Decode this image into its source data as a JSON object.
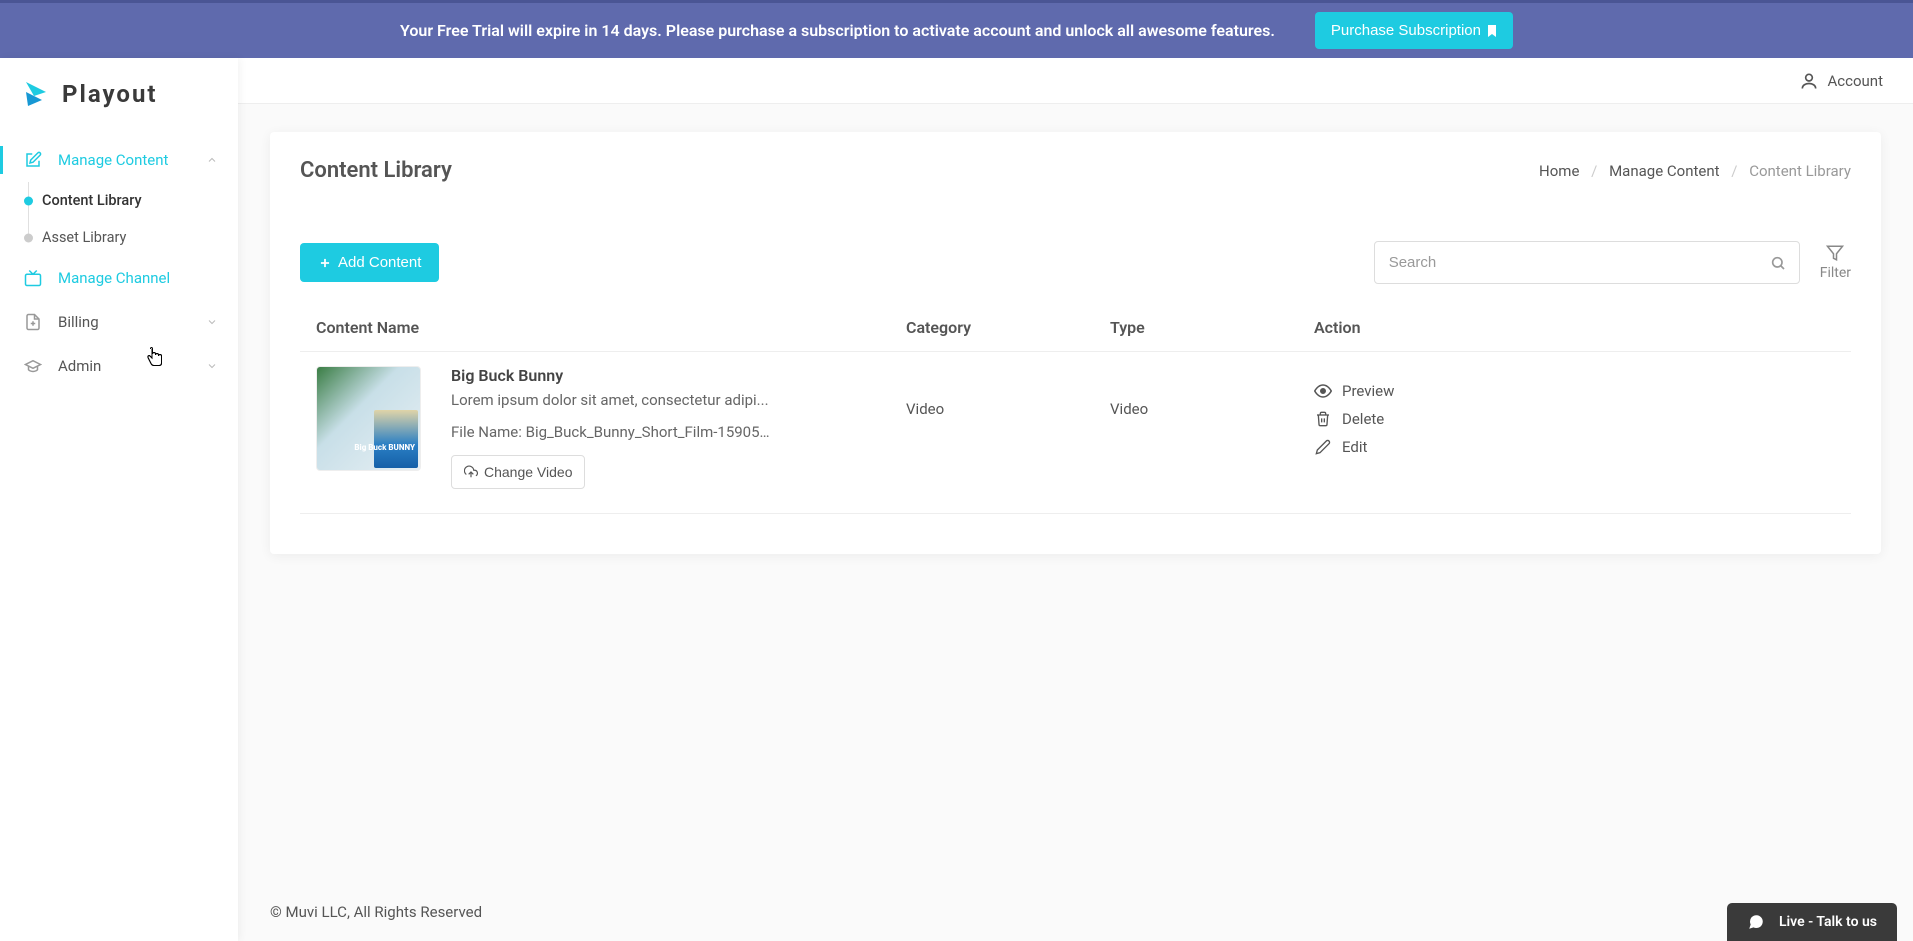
{
  "banner": {
    "text": "Your Free Trial will expire in 14 days. Please purchase a subscription to activate account and unlock all awesome features.",
    "button": "Purchase Subscription"
  },
  "brand": {
    "name": "Playout"
  },
  "topbar": {
    "account": "Account"
  },
  "sidebar": {
    "items": [
      {
        "label": "Manage Content",
        "expandable": true,
        "active": true
      },
      {
        "label": "Manage Channel",
        "hover": true
      },
      {
        "label": "Billing",
        "expandable": true
      },
      {
        "label": "Admin",
        "expandable": true
      }
    ],
    "sub": [
      {
        "label": "Content Library",
        "selected": true
      },
      {
        "label": "Asset Library"
      }
    ]
  },
  "page": {
    "title": "Content Library",
    "crumbs": {
      "home": "Home",
      "l1": "Manage Content",
      "l2": "Content Library"
    }
  },
  "toolbar": {
    "add": "Add Content",
    "search_placeholder": "Search",
    "filter": "Filter"
  },
  "table": {
    "headers": {
      "name": "Content Name",
      "category": "Category",
      "type": "Type",
      "action": "Action"
    },
    "rows": [
      {
        "title": "Big Buck Bunny",
        "desc": "Lorem ipsum dolor sit amet, consectetur adipi...",
        "file_prefix": "File Name: ",
        "file": "Big_Buck_Bunny_Short_Film-15905...",
        "change": "Change Video",
        "category": "Video",
        "type": "Video",
        "thumb_badge": "Big Buck\nBUNNY"
      }
    ],
    "actions": {
      "preview": "Preview",
      "delete": "Delete",
      "edit": "Edit"
    }
  },
  "footer": "© Muvi LLC, All Rights Reserved",
  "chat": "Live - Talk to us",
  "colors": {
    "accent": "#1ecbe1",
    "banner": "#5f6aad"
  }
}
